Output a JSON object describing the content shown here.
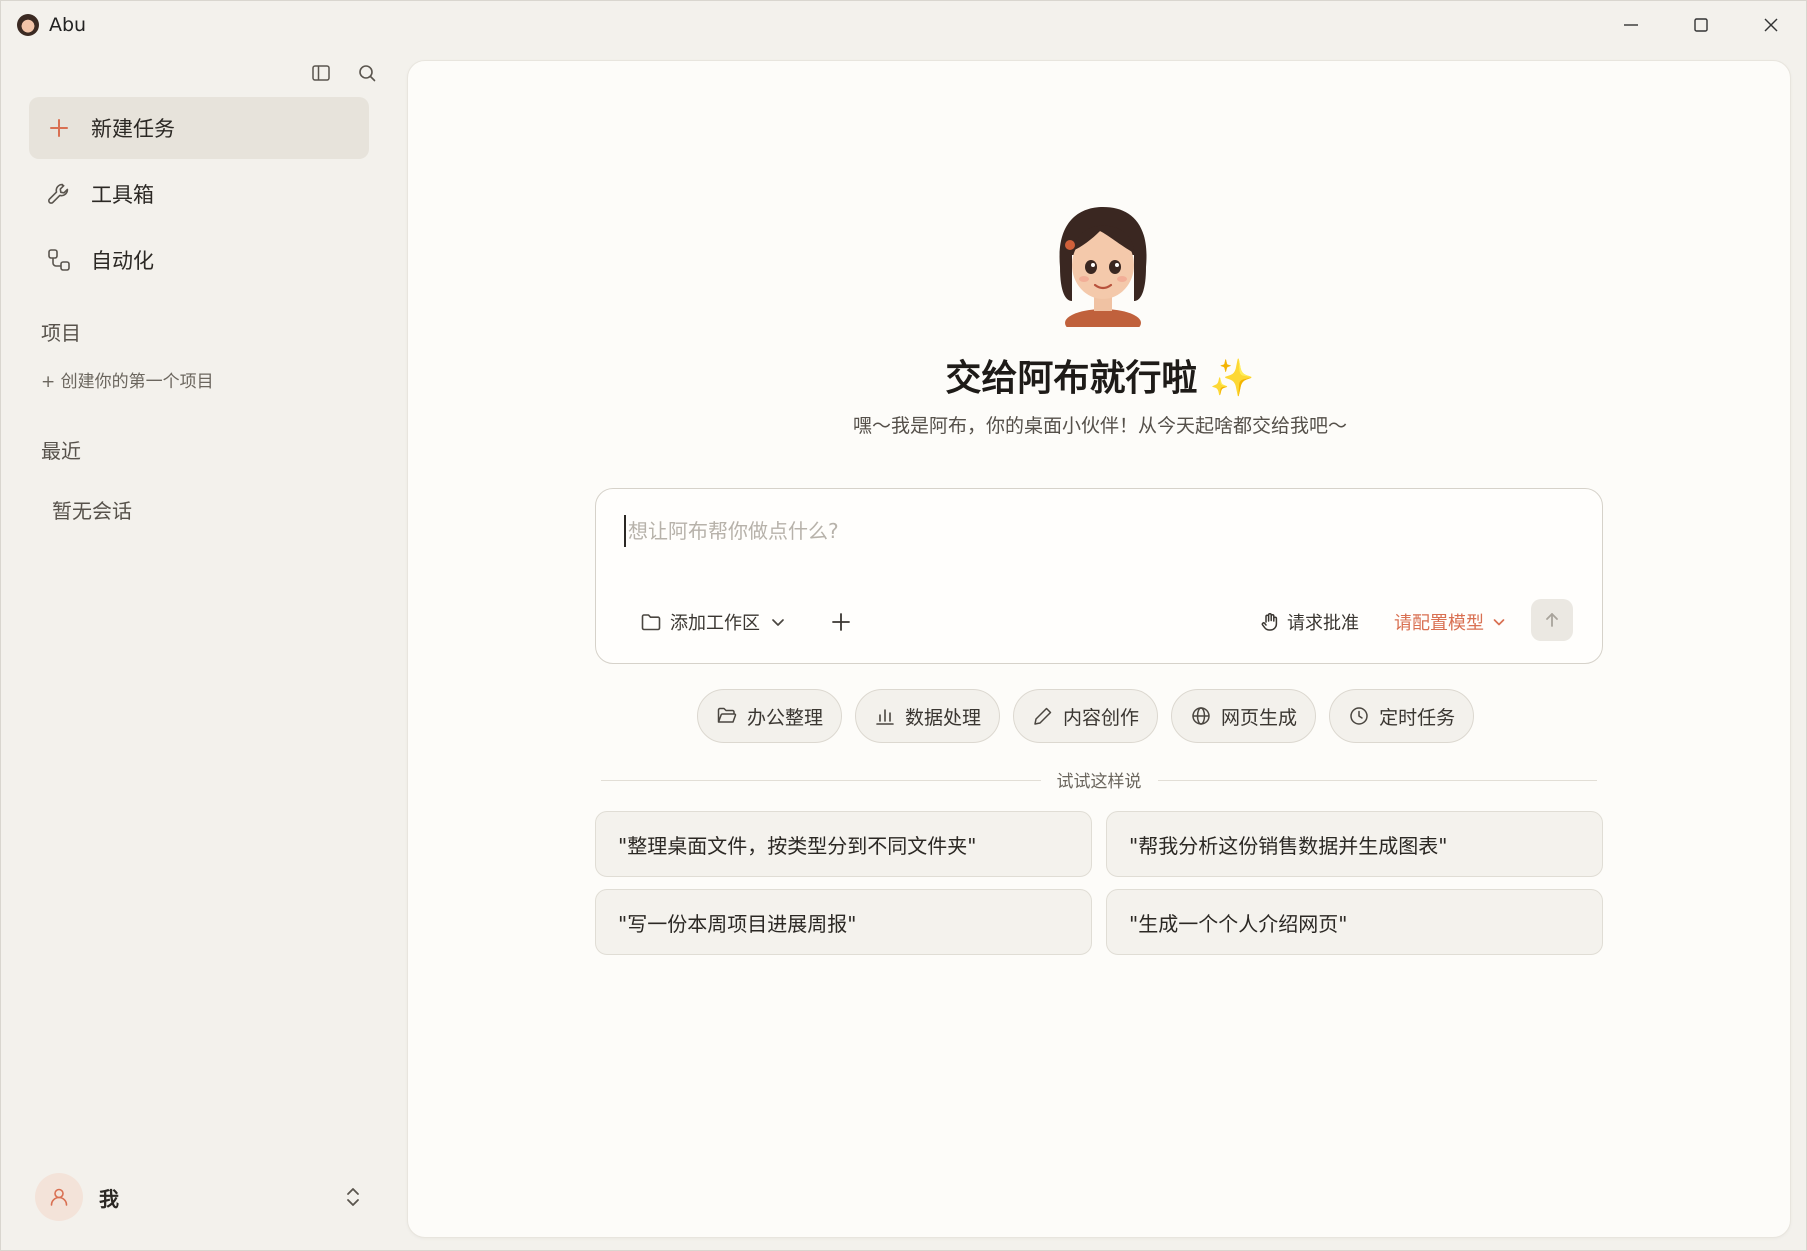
{
  "window": {
    "title": "Abu",
    "controls": [
      "minimize",
      "maximize",
      "close"
    ]
  },
  "sidebar": {
    "nav": [
      {
        "label": "新建任务",
        "icon": "plus-icon",
        "active": true
      },
      {
        "label": "工具箱",
        "icon": "wrench-icon",
        "active": false
      },
      {
        "label": "自动化",
        "icon": "workflow-icon",
        "active": false
      }
    ],
    "projects_title": "项目",
    "create_project": "+ 创建你的第一个项目",
    "recent_title": "最近",
    "empty_chats": "暂无会话",
    "user_name": "我"
  },
  "main": {
    "title": "交给阿布就行啦 ✨",
    "subtitle": "嘿～我是阿布，你的桌面小伙伴！从今天起啥都交给我吧～",
    "composer": {
      "placeholder": "想让阿布帮你做点什么?",
      "value": "",
      "workspace_label": "添加工作区",
      "approve_label": "请求批准",
      "model_label": "请配置模型"
    },
    "chips": [
      {
        "label": "办公整理",
        "icon": "folder-open-icon"
      },
      {
        "label": "数据处理",
        "icon": "bar-chart-icon"
      },
      {
        "label": "内容创作",
        "icon": "pen-icon"
      },
      {
        "label": "网页生成",
        "icon": "globe-icon"
      },
      {
        "label": "定时任务",
        "icon": "clock-icon"
      }
    ],
    "try_label": "试试这样说",
    "suggestions": [
      "\"整理桌面文件，按类型分到不同文件夹\"",
      "\"帮我分析这份销售数据并生成图表\"",
      "\"写一份本周项目进展周报\"",
      "\"生成一个个人介绍网页\""
    ]
  },
  "colors": {
    "accent": "#d97052",
    "sidebar_bg": "#f3f1ec",
    "main_bg": "#fdfcf9",
    "active_item_bg": "#e7e3db"
  }
}
